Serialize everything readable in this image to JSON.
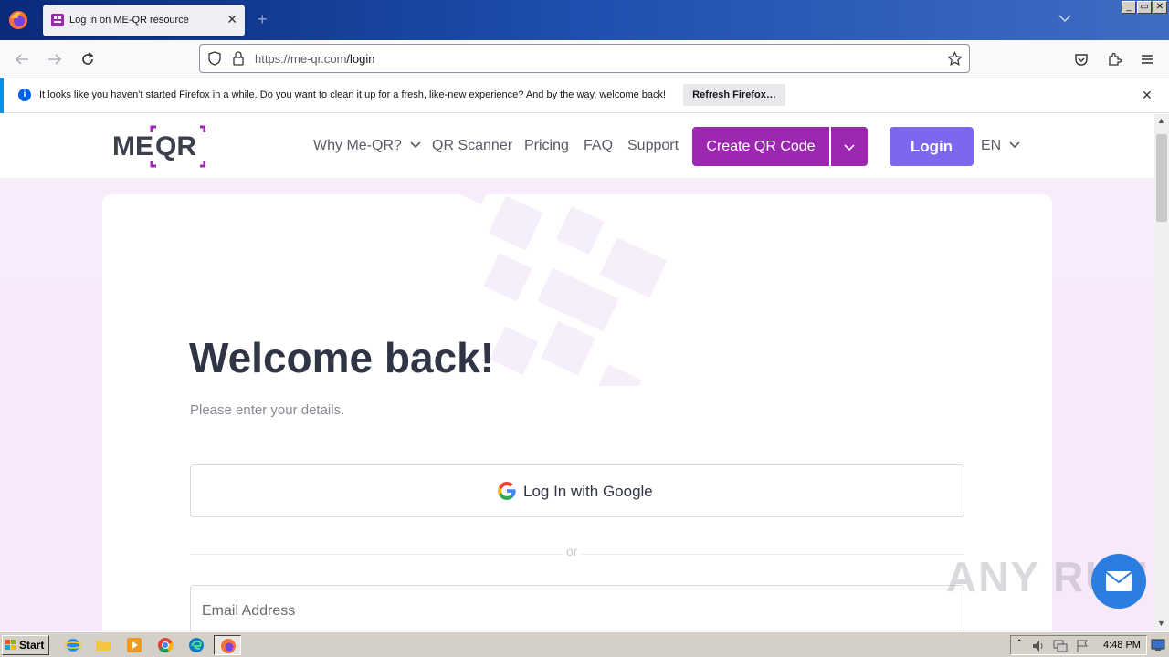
{
  "browser": {
    "tab_title": "Log in on ME-QR resource",
    "new_tab_symbol": "+",
    "url_host": "https://me-qr.com",
    "url_path": "/login",
    "window_buttons": [
      "_",
      "▭",
      "✕"
    ]
  },
  "notification": {
    "message": "It looks like you haven't started Firefox in a while. Do you want to clean it up for a fresh, like-new experience? And by the way, welcome back!",
    "button": "Refresh Firefox…",
    "close": "✕"
  },
  "site": {
    "logo_text": "MEQR",
    "nav": {
      "why": "Why Me-QR?",
      "scanner": "QR Scanner",
      "pricing": "Pricing",
      "faq": "FAQ",
      "support": "Support"
    },
    "create_button": "Create QR Code",
    "login_button": "Login",
    "language": "EN"
  },
  "login": {
    "title": "Welcome back!",
    "subtitle": "Please enter your details.",
    "google_button": "Log In with Google",
    "divider_text": "or",
    "email_placeholder": "Email Address"
  },
  "watermark": "ANY RUN",
  "taskbar": {
    "start_label": "Start",
    "clock": "4:48 PM"
  },
  "colors": {
    "brand_purple": "#9c27b0",
    "login_violet": "#7b68ee",
    "page_bg": "#f8ecfb"
  }
}
